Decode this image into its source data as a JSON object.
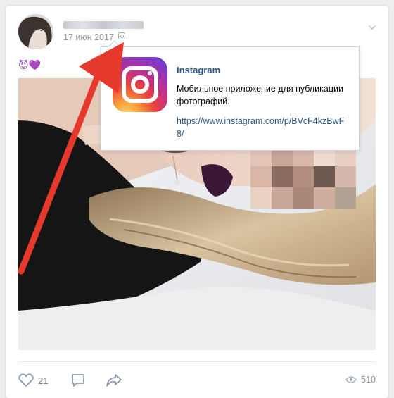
{
  "post": {
    "date": "17 июн 2017",
    "emoji": {
      "devil": "😈",
      "heart": "💜"
    },
    "likes": "21",
    "views": "510"
  },
  "popup": {
    "title": "Instagram",
    "description": "Мобильное приложение для публикации фотографий.",
    "link": "https://www.instagram.com/p/BVcF4kzBwF8/"
  },
  "colors": {
    "link": "#2a5885",
    "muted": "#939393",
    "annotation_arrow": "#e5392b",
    "card_bg": "#ffffff",
    "page_bg": "#edeef0"
  },
  "icons": {
    "source": "instagram-icon",
    "menu": "chevron-down-icon",
    "like": "heart-icon",
    "comment": "comment-icon",
    "share": "share-icon",
    "views": "eye-icon"
  }
}
